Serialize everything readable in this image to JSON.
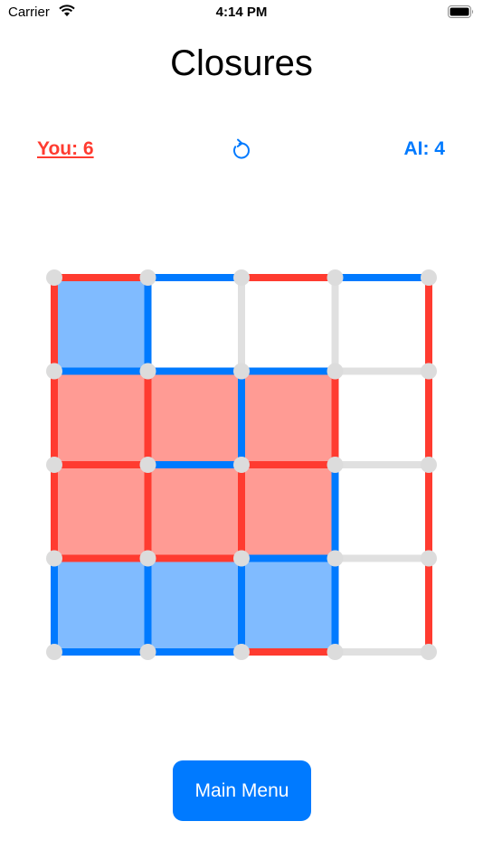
{
  "status_bar": {
    "carrier": "Carrier",
    "time": "4:14 PM"
  },
  "title": "Closures",
  "score": {
    "you": "You: 6",
    "ai": "AI: 4"
  },
  "controls": {
    "undo_icon": "undo-arrow-icon",
    "menu_label": "Main Menu"
  },
  "colors": {
    "player": "#ff3b30",
    "ai": "#007aff",
    "empty_line": "#e0e0e0",
    "dot": "#dcdcdc",
    "player_box": "#ff9b94",
    "ai_box": "#80bbff"
  },
  "board": {
    "rows": 4,
    "cols": 4,
    "horizontal_edges": [
      [
        "player",
        "ai",
        "player",
        "ai"
      ],
      [
        "ai",
        "ai",
        "ai",
        "empty"
      ],
      [
        "player",
        "ai",
        "player",
        "empty"
      ],
      [
        "player",
        "player",
        "ai",
        "empty"
      ],
      [
        "ai",
        "ai",
        "player",
        "empty"
      ]
    ],
    "vertical_edges": [
      [
        "player",
        "ai",
        "empty",
        "empty",
        "player"
      ],
      [
        "player",
        "player",
        "ai",
        "player",
        "player"
      ],
      [
        "player",
        "player",
        "player",
        "ai",
        "player"
      ],
      [
        "ai",
        "ai",
        "ai",
        "ai",
        "player"
      ]
    ],
    "boxes": [
      [
        "ai",
        "empty",
        "empty",
        "empty"
      ],
      [
        "player",
        "player",
        "player",
        "empty"
      ],
      [
        "player",
        "player",
        "player",
        "empty"
      ],
      [
        "ai",
        "ai",
        "ai",
        "empty"
      ]
    ]
  }
}
